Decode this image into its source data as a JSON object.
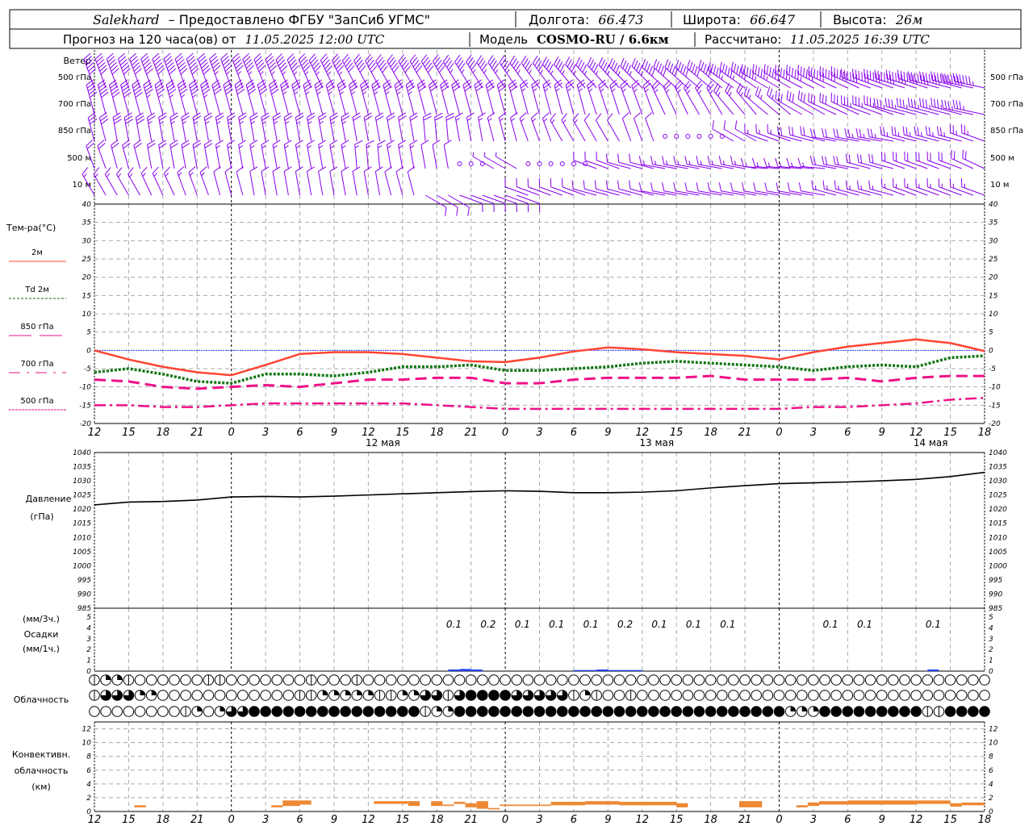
{
  "header": {
    "station": "Salekhard",
    "provider": "– Предоставлено ФГБУ \"ЗапСиб УГМС\"",
    "lon_label": "Долгота:",
    "lon": "66.473",
    "lat_label": "Широта:",
    "lat": "66.647",
    "alt_label": "Высота:",
    "alt": "26м",
    "forecast_label": "Прогноз на 120 часа(ов) от",
    "forecast_start": "11.05.2025 12:00 UTC",
    "model_label": "Модель",
    "model": "COSMO-RU / 6.6км",
    "calc_label": "Рассчитано:",
    "calc_time": "11.05.2025 16:39 UTC"
  },
  "labels": {
    "wind": "Ветер",
    "wind_levels": [
      "500 гПа",
      "700 гПа",
      "850 гПа",
      "500 м",
      "10 м"
    ],
    "temp": "Тем-ра(°C)",
    "temp_legend": [
      "2м",
      "Td 2м",
      "850 гПа",
      "700 гПа",
      "500 гПа"
    ],
    "pressure": [
      "Давление",
      "(гПа)"
    ],
    "precip": [
      "(мм/3ч.)",
      "Осадки",
      "(мм/1ч.)"
    ],
    "clouds": "Облачность",
    "convective": [
      "Конвективн.",
      "облачность",
      "(км)"
    ]
  },
  "colors": {
    "t2m": "#ff4433",
    "td2m": "#117711",
    "t850": "#ee1188",
    "t700": "#ee1188",
    "zero": "#3344ff",
    "wind": "#8800ee",
    "precip": "#2244ee",
    "conv": "#ee8833",
    "pressure": "#000000"
  },
  "chart_data": {
    "type": "line",
    "time_ticks": [
      "12",
      "15",
      "18",
      "21",
      "0",
      "3",
      "6",
      "9",
      "12",
      "15",
      "18",
      "21",
      "0",
      "3",
      "6",
      "9",
      "12",
      "15",
      "18",
      "21",
      "0",
      "3",
      "6",
      "9",
      "12",
      "15",
      "18"
    ],
    "date_labels": [
      {
        "hour": 24,
        "text": "12 мая"
      },
      {
        "hour": 48,
        "text": "13 мая"
      },
      {
        "hour": 72,
        "text": "14 мая"
      }
    ],
    "hours": [
      0,
      3,
      6,
      9,
      12,
      15,
      18,
      21,
      24,
      27,
      30,
      33,
      36,
      39,
      42,
      45,
      48,
      51,
      54,
      57,
      60,
      63,
      66,
      69,
      72,
      75,
      78
    ],
    "wind": {
      "units_note": "",
      "levels": [
        {
          "dir": [
            340,
            340,
            340,
            340,
            340,
            338,
            336,
            334,
            332,
            330,
            330,
            328,
            326,
            324,
            320,
            318,
            315,
            312,
            310,
            305,
            300,
            298,
            295,
            290,
            288,
            285,
            282
          ],
          "speed": [
            30,
            30,
            30,
            30,
            28,
            28,
            28,
            27,
            26,
            25,
            25,
            24,
            24,
            24,
            24,
            24,
            24,
            25,
            26,
            27,
            28,
            29,
            30,
            31,
            32,
            33,
            34
          ]
        },
        {
          "dir": [
            345,
            345,
            345,
            345,
            345,
            345,
            345,
            345,
            345,
            345,
            345,
            345,
            345,
            345,
            345,
            342,
            340,
            335,
            330,
            320,
            310,
            300,
            295,
            290,
            285,
            285,
            282
          ],
          "speed": [
            25,
            25,
            22,
            22,
            20,
            20,
            18,
            18,
            17,
            17,
            16,
            15,
            15,
            14,
            14,
            14,
            14,
            13,
            13,
            13,
            14,
            15,
            16,
            17,
            18,
            18,
            18
          ]
        },
        {
          "dir": [
            345,
            350,
            350,
            350,
            350,
            350,
            350,
            350,
            350,
            350,
            355,
            350,
            345,
            340,
            330,
            330,
            340,
            0,
            0,
            300,
            290,
            285,
            280,
            280,
            285,
            285,
            290
          ],
          "speed": [
            15,
            15,
            14,
            14,
            12,
            12,
            12,
            12,
            11,
            11,
            10,
            9,
            8,
            8,
            7,
            6,
            5,
            0,
            0,
            6,
            8,
            10,
            11,
            12,
            12,
            12,
            12
          ]
        },
        {
          "dir": [
            340,
            345,
            350,
            350,
            350,
            350,
            350,
            350,
            355,
            350,
            350,
            0,
            300,
            0,
            0,
            290,
            285,
            280,
            280,
            280,
            275,
            275,
            280,
            285,
            290,
            290,
            295
          ],
          "speed": [
            10,
            10,
            10,
            10,
            9,
            9,
            9,
            9,
            8,
            8,
            6,
            0,
            4,
            0,
            0,
            5,
            6,
            7,
            7,
            8,
            8,
            9,
            10,
            10,
            10,
            10,
            10
          ]
        },
        {
          "dir": [
            330,
            330,
            335,
            340,
            345,
            350,
            350,
            350,
            350,
            345,
            120,
            110,
            110,
            290,
            290,
            285,
            285,
            280,
            280,
            280,
            280,
            280,
            285,
            285,
            290,
            290,
            290
          ],
          "speed": [
            8,
            8,
            7,
            7,
            6,
            6,
            6,
            5,
            5,
            5,
            5,
            6,
            5,
            5,
            6,
            6,
            6,
            6,
            6,
            6,
            6,
            6,
            7,
            7,
            7,
            7,
            7
          ]
        }
      ]
    },
    "temperature": {
      "ylim": [
        -20,
        40
      ],
      "yticks": [
        40,
        35,
        30,
        25,
        20,
        15,
        10,
        5,
        0,
        -5,
        -10,
        -15,
        -20
      ],
      "series": [
        {
          "name": "2м",
          "values": [
            0,
            -2.5,
            -4.5,
            -6,
            -6.8,
            -4,
            -1,
            -0.5,
            -0.5,
            -1,
            -2,
            -3,
            -3.2,
            -2,
            -0.3,
            0.8,
            0.3,
            -0.5,
            -1,
            -1.5,
            -2.5,
            -0.5,
            1,
            2,
            3,
            2,
            -0.2
          ]
        },
        {
          "name": "Td 2м",
          "values": [
            -6,
            -5,
            -6.5,
            -8.5,
            -9,
            -6.5,
            -6.5,
            -7,
            -6,
            -4.5,
            -4.5,
            -4,
            -5.5,
            -5.5,
            -5,
            -4.5,
            -3.5,
            -3,
            -3.5,
            -4,
            -4.5,
            -5.5,
            -4.5,
            -4,
            -4.5,
            -2,
            -1.5
          ]
        },
        {
          "name": "850 гПа",
          "values": [
            -8,
            -8.5,
            -10,
            -10.5,
            -10,
            -9.5,
            -10,
            -9,
            -8,
            -8,
            -7.5,
            -7.5,
            -9,
            -9,
            -8,
            -7.5,
            -7.5,
            -7.5,
            -7,
            -8,
            -8,
            -8,
            -7.5,
            -8.5,
            -7.5,
            -7,
            -7
          ]
        },
        {
          "name": "700 гПа",
          "values": [
            -15,
            -15,
            -15.5,
            -15.5,
            -15,
            -14.5,
            -14.5,
            -14.5,
            -14.5,
            -14.5,
            -15,
            -15.5,
            -16,
            -16,
            -16,
            -16,
            -16,
            -16,
            -16,
            -16,
            -16,
            -15.5,
            -15.5,
            -15,
            -14.5,
            -13.5,
            -13
          ]
        }
      ]
    },
    "pressure": {
      "ylim": [
        985,
        1040
      ],
      "yticks": [
        1040,
        1035,
        1030,
        1025,
        1020,
        1015,
        1010,
        1005,
        1000,
        995,
        990,
        985
      ],
      "values": [
        1021.5,
        1022.5,
        1022.7,
        1023.2,
        1024.3,
        1024.5,
        1024.3,
        1024.6,
        1025,
        1025.4,
        1025.8,
        1026.2,
        1026.5,
        1026.3,
        1025.8,
        1025.8,
        1026,
        1026.5,
        1027.5,
        1028.3,
        1029,
        1029.3,
        1029.6,
        1030,
        1030.5,
        1031.5,
        1033
      ]
    },
    "precipitation": {
      "ylim": [
        0,
        5
      ],
      "yticks": [
        5,
        4,
        3,
        2,
        1,
        0
      ],
      "labels_3h": [
        {
          "hour": 31.5,
          "text": "0.1"
        },
        {
          "hour": 34.5,
          "text": "0.2"
        },
        {
          "hour": 37.5,
          "text": "0.1"
        },
        {
          "hour": 40.5,
          "text": "0.1"
        },
        {
          "hour": 43.5,
          "text": "0.1"
        },
        {
          "hour": 46.5,
          "text": "0.2"
        },
        {
          "hour": 49.5,
          "text": "0.1"
        },
        {
          "hour": 52.5,
          "text": "0.1"
        },
        {
          "hour": 55.5,
          "text": "0.1"
        },
        {
          "hour": 64.5,
          "text": "0.1"
        },
        {
          "hour": 67.5,
          "text": "0.1"
        },
        {
          "hour": 73.5,
          "text": "0.1"
        }
      ],
      "hourly": [
        [
          32,
          0.15
        ],
        [
          33,
          0.2
        ],
        [
          34,
          0.15
        ],
        [
          43,
          0.1
        ],
        [
          44,
          0.1
        ],
        [
          45,
          0.15
        ],
        [
          46,
          0.1
        ],
        [
          47,
          0.1
        ],
        [
          48,
          0.1
        ],
        [
          74,
          0.15
        ]
      ]
    },
    "cloud_rows": [
      "2112000000220000000200020000000000000000000000000000000000000000000000000000000",
      "2333110000000000002211111221133234444333332120020000000000000000000000000000000",
      "0000000021013344444444444444421144444444444444444444444444444111444444444224444"
    ],
    "convective": {
      "ylim": [
        0,
        13
      ],
      "yticks": [
        12,
        10,
        8,
        6,
        4,
        2,
        0
      ],
      "bars": [
        [
          3.5,
          4.5,
          0.6,
          0.9
        ],
        [
          15.5,
          16.5,
          0.6,
          0.9
        ],
        [
          16.5,
          18,
          0.8,
          1.6
        ],
        [
          18,
          19,
          1.0,
          1.6
        ],
        [
          24.5,
          27.5,
          1.1,
          1.5
        ],
        [
          27.5,
          28.5,
          0.8,
          1.5
        ],
        [
          29.5,
          30.5,
          0.8,
          1.5
        ],
        [
          30.5,
          31.5,
          0.8,
          1.0
        ],
        [
          31.5,
          32.5,
          1.1,
          1.4
        ],
        [
          32.5,
          33.5,
          0.6,
          1.2
        ],
        [
          33.5,
          34.5,
          0.4,
          1.5
        ],
        [
          34.5,
          35.5,
          0.3,
          0.5
        ],
        [
          35.5,
          38,
          0.8,
          1.0
        ],
        [
          38,
          40,
          0.8,
          1.0
        ],
        [
          40,
          43,
          0.9,
          1.4
        ],
        [
          43,
          46,
          1.0,
          1.5
        ],
        [
          46,
          51,
          0.9,
          1.4
        ],
        [
          51,
          52,
          0.6,
          1.2
        ],
        [
          56.5,
          58.5,
          0.6,
          1.5
        ],
        [
          61.5,
          62.5,
          0.6,
          0.9
        ],
        [
          62.5,
          63.5,
          0.8,
          1.3
        ],
        [
          63.5,
          66,
          1.0,
          1.5
        ],
        [
          66,
          72,
          1.0,
          1.6
        ],
        [
          72,
          75,
          1.1,
          1.6
        ],
        [
          75,
          76,
          0.7,
          1.2
        ],
        [
          76,
          78,
          0.9,
          1.3
        ]
      ]
    }
  }
}
